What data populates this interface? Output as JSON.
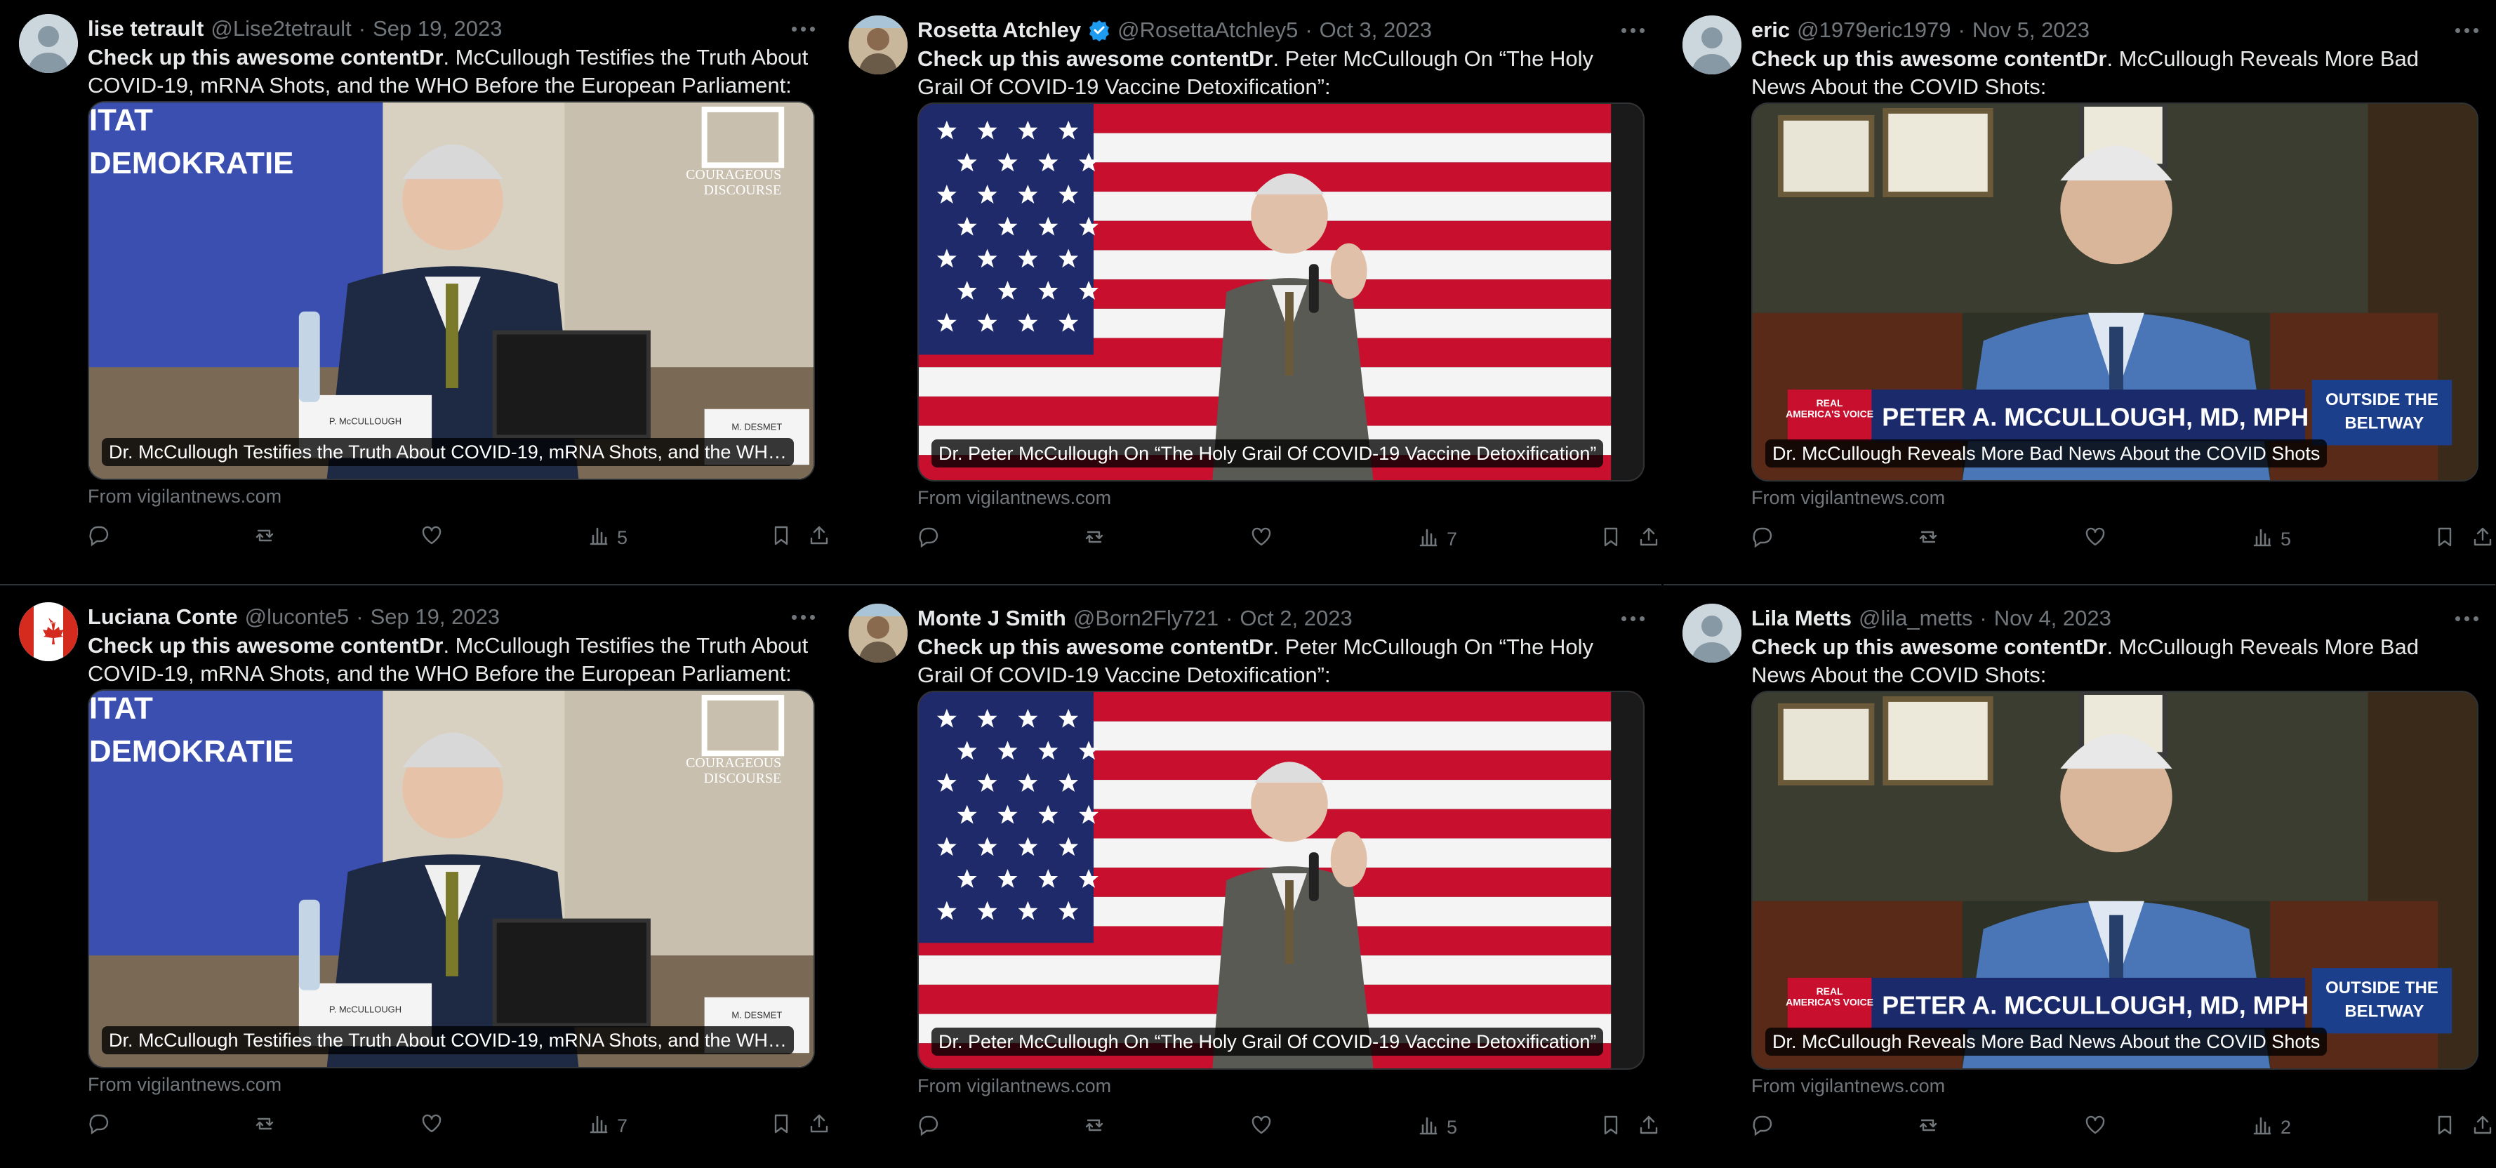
{
  "tweets": [
    {
      "name": "lise tetrault",
      "handle": "@Lise2tetrault",
      "date": "Sep 19, 2023",
      "verified": false,
      "avatar": "default-avatar",
      "text_bold": "Check up this awesome contentDr",
      "text_rest": ". McCullough Testifies the Truth About COVID-19, mRNA Shots, and the WHO Before the European Parliament:",
      "caption": "Dr. McCullough Testifies the Truth About COVID-19, mRNA Shots, and the WH…",
      "image": "parliament",
      "image_text": {
        "banner": "ITAT\nDEMOKRATIE",
        "logo": "COURAGEOUS\nDISCOURSE",
        "nameplate": "P. McCULLOUGH",
        "nameplate2": "M. DESMET"
      },
      "source": "From vigilantnews.com",
      "views": "5"
    },
    {
      "name": "Rosetta Atchley",
      "handle": "@RosettaAtchley5",
      "date": "Oct 3, 2023",
      "verified": true,
      "avatar": "photo-avatar",
      "text_bold": "Check up this awesome contentDr",
      "text_rest": ". Peter McCullough On “The Holy Grail Of COVID-19 Vaccine Detoxification”:",
      "caption": "Dr. Peter McCullough On “The Holy Grail Of COVID-19 Vaccine Detoxification”",
      "image": "flag",
      "source": "From vigilantnews.com",
      "views": "7"
    },
    {
      "name": "eric",
      "handle": "@1979eric1979",
      "date": "Nov 5, 2023",
      "verified": false,
      "avatar": "default-avatar",
      "text_bold": "Check up this awesome contentDr",
      "text_rest": ". McCullough Reveals More Bad News About the COVID Shots:",
      "caption": "Dr. McCullough Reveals More Bad News About the COVID Shots",
      "image": "studio",
      "image_text": {
        "lower_third": "PETER A. MCCULLOUGH, MD, MPH",
        "network": "REAL AMERICA'S VOICE",
        "show": "OUTSIDE THE BELTWAY"
      },
      "source": "From vigilantnews.com",
      "views": "5"
    },
    {
      "name": "Luciana Conte",
      "handle": "@luconte5",
      "date": "Sep 19, 2023",
      "verified": false,
      "avatar": "canada-flag-avatar",
      "text_bold": "Check up this awesome contentDr",
      "text_rest": ". McCullough Testifies the Truth About COVID-19, mRNA Shots, and the WHO Before the European Parliament:",
      "caption": "Dr. McCullough Testifies the Truth About COVID-19, mRNA Shots, and the WH…",
      "image": "parliament",
      "image_text": {
        "banner": "ITAT\nDEMOKRATIE",
        "logo": "COURAGEOUS\nDISCOURSE",
        "nameplate": "P. McCULLOUGH",
        "nameplate2": "M. DESMET"
      },
      "source": "From vigilantnews.com",
      "views": "7"
    },
    {
      "name": "Monte J Smith",
      "handle": "@Born2Fly721",
      "date": "Oct 2, 2023",
      "verified": false,
      "avatar": "photo-avatar",
      "text_bold": "Check up this awesome contentDr",
      "text_rest": ". Peter McCullough On “The Holy Grail Of COVID-19 Vaccine Detoxification”:",
      "caption": "Dr. Peter McCullough On “The Holy Grail Of COVID-19 Vaccine Detoxification”",
      "image": "flag",
      "source": "From vigilantnews.com",
      "views": "5"
    },
    {
      "name": "Lila Metts",
      "handle": "@lila_metts",
      "date": "Nov 4, 2023",
      "verified": false,
      "avatar": "default-avatar",
      "text_bold": "Check up this awesome contentDr",
      "text_rest": ". McCullough Reveals More Bad News About the COVID Shots:",
      "caption": "Dr. McCullough Reveals More Bad News About the COVID Shots",
      "image": "studio",
      "image_text": {
        "lower_third": "PETER A. MCCULLOUGH, MD, MPH",
        "network": "REAL AMERICA'S VOICE",
        "show": "OUTSIDE THE BELTWAY"
      },
      "source": "From vigilantnews.com",
      "views": "2"
    }
  ],
  "colors": {
    "background": "#000000",
    "text": "#e7e9ea",
    "muted": "#71767b",
    "verified": "#1d9bf0",
    "border": "#2f3336"
  },
  "icons": [
    "reply-icon",
    "retweet-icon",
    "like-icon",
    "views-icon",
    "bookmark-icon",
    "share-icon",
    "more-icon",
    "verified-icon"
  ]
}
